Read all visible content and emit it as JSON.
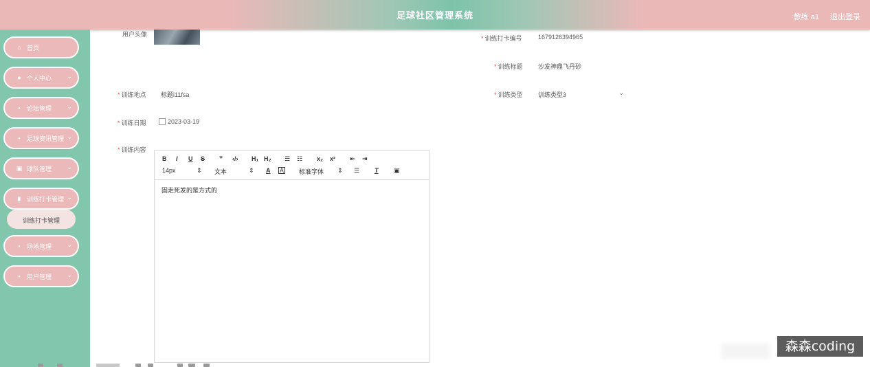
{
  "header": {
    "title": "足球社区管理系统",
    "user": "教练 a1",
    "logout": "退出登录"
  },
  "sidebar": {
    "items": [
      {
        "label": "首页",
        "icon": "home-icon"
      },
      {
        "label": "个人中心",
        "icon": "user-icon"
      },
      {
        "label": "论坛管理",
        "icon": "grid-icon"
      },
      {
        "label": "足球资讯管理",
        "icon": "grid-icon"
      },
      {
        "label": "球队管理",
        "icon": "briefcase-icon"
      },
      {
        "label": "训练打卡管理",
        "icon": "bar-chart-icon"
      },
      {
        "label": "场地管理",
        "icon": "grid-icon"
      },
      {
        "label": "用户管理",
        "icon": "grid-icon"
      }
    ],
    "submenu_label": "训练打卡管理"
  },
  "form": {
    "avatar_label": "用户头像",
    "checkin_no_label": "训练打卡编号",
    "checkin_no": "1679126394965",
    "title_label": "训练标题",
    "title_value": "沙发神鼎飞丹砂",
    "location_label": "训练地点",
    "location_value": "标题i11fsa",
    "type_label": "训练类型",
    "type_value": "训练类型3",
    "date_label": "训练日期",
    "date_value": "2023-03-19",
    "content_label": "训练内容"
  },
  "editor": {
    "toolbar_row1": [
      "B",
      "I",
      "U",
      "S",
      "❞",
      "‹/›",
      "H₁",
      "H₂",
      "☰",
      "☷",
      "x₂",
      "x²",
      "⇤",
      "⇥"
    ],
    "size": "14px",
    "style": "文本",
    "font": "标准字体",
    "content": "固走死发的是方式的"
  },
  "watermark": "森森coding"
}
